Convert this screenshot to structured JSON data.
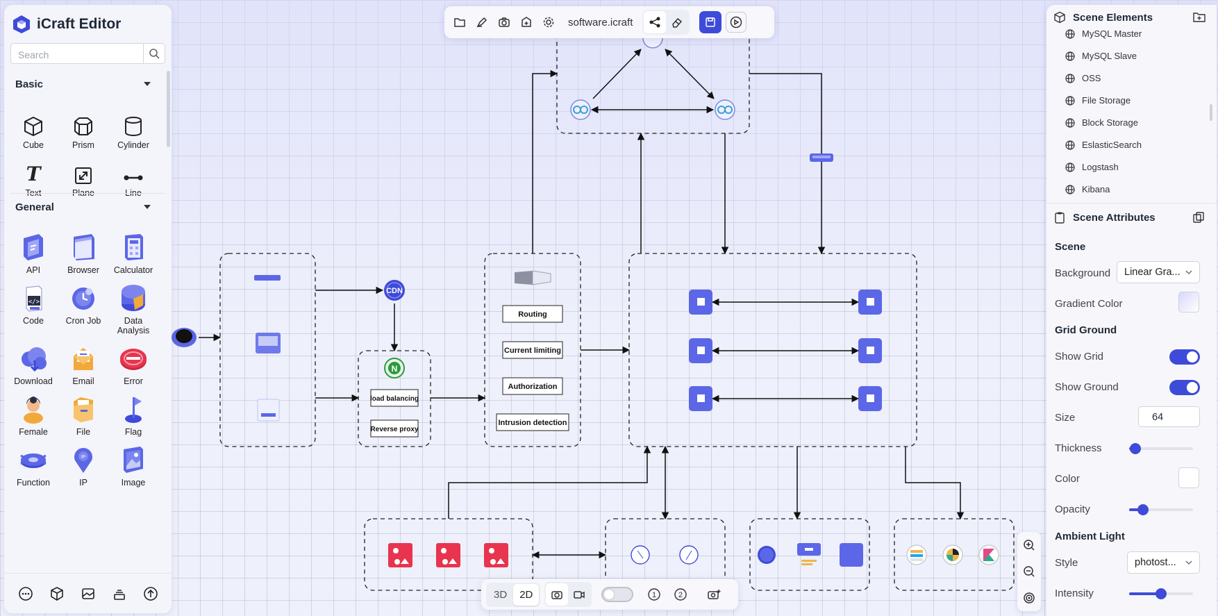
{
  "app": {
    "title": "iCraft Editor"
  },
  "search": {
    "placeholder": "Search"
  },
  "library": {
    "basic": {
      "title": "Basic",
      "items": [
        "Cube",
        "Prism",
        "Cylinder",
        "Text",
        "Plane",
        "Line"
      ]
    },
    "general": {
      "title": "General",
      "items": [
        "API",
        "Browser",
        "Calculator",
        "Code",
        "Cron Job",
        "Data Analysis",
        "Download",
        "Email",
        "Error",
        "Female",
        "File",
        "Flag",
        "Function",
        "IP",
        "Image"
      ]
    }
  },
  "toolbar": {
    "filename": "software.icraft"
  },
  "view": {
    "mode_3d": "3D",
    "mode_2d": "2D",
    "layer1": "1",
    "layer2": "2"
  },
  "diagram": {
    "labels": {
      "cdn": "CDN",
      "nginx": "N",
      "load_balancing": "load balancing",
      "reverse_proxy": "Reverse proxy",
      "routing": "Routing",
      "current_limiting": "Current limiting",
      "authorization": "Authorization",
      "intrusion_detection": "Intrusion detection"
    }
  },
  "scene_elements": {
    "title": "Scene Elements",
    "items": [
      "MySQL Master",
      "MySQL Slave",
      "OSS",
      "File Storage",
      "Block Storage",
      "EslasticSearch",
      "Logstash",
      "Kibana"
    ]
  },
  "scene_attributes": {
    "title": "Scene Attributes",
    "scene_section": "Scene",
    "background_label": "Background",
    "background_value": "Linear Gra...",
    "gradient_color_label": "Gradient Color",
    "grid_ground_section": "Grid Ground",
    "show_grid_label": "Show Grid",
    "show_grid": true,
    "show_ground_label": "Show Ground",
    "show_ground": true,
    "size_label": "Size",
    "size_value": "64",
    "thickness_label": "Thickness",
    "thickness": 0.1,
    "color_label": "Color",
    "opacity_label": "Opacity",
    "opacity": 0.22,
    "ambient_light_section": "Ambient Light",
    "style_label": "Style",
    "style_value": "photost...",
    "intensity_label": "Intensity",
    "intensity": 0.5
  },
  "colors": {
    "accent": "#3e4bd8",
    "node_blue": "#5b67e6",
    "node_red": "#e8344e"
  }
}
